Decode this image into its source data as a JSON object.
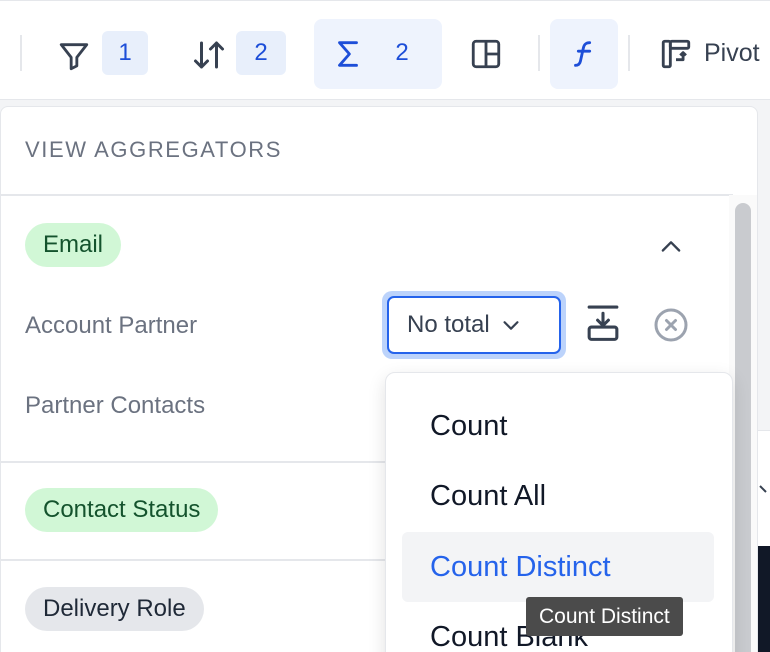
{
  "toolbar": {
    "filter": {
      "icon": "filter-icon",
      "count": "1"
    },
    "sort": {
      "icon": "sort-icon",
      "count": "2"
    },
    "aggregate": {
      "icon": "sigma-icon",
      "count": "2"
    },
    "layout": {
      "icon": "layout-icon"
    },
    "formula": {
      "icon": "formula-icon"
    },
    "pivot": {
      "icon": "pivot-icon",
      "label": "Pivot"
    }
  },
  "panel": {
    "title": "VIEW AGGREGATORS",
    "groups": [
      {
        "name": "Email",
        "expanded": true,
        "rows": [
          {
            "label": "Account Partner",
            "value": "No total"
          },
          {
            "label": "Partner Contacts"
          }
        ]
      },
      {
        "name": "Contact Status"
      },
      {
        "name": "Delivery Role"
      }
    ]
  },
  "dropdown": {
    "options": [
      "Count",
      "Count All",
      "Count Distinct",
      "Count Blank"
    ],
    "hovered": "Count Distinct"
  },
  "tooltip": "Count Distinct",
  "colors": {
    "accent": "#2563eb",
    "green_pill": "#d1f7d6",
    "grey_pill": "#e5e7eb",
    "tooltip_bg": "#4b4b4b"
  }
}
